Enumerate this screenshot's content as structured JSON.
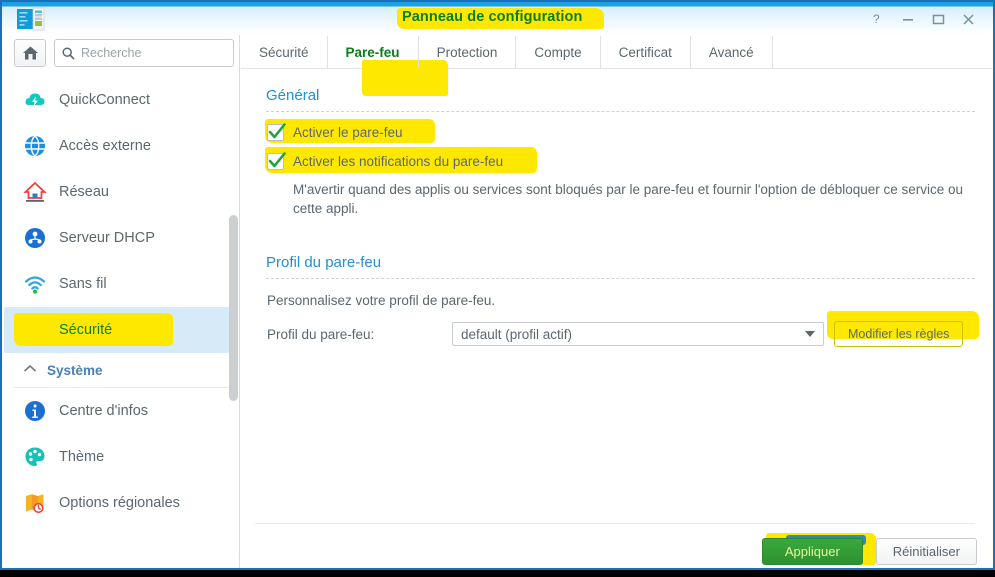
{
  "window": {
    "title": "Panneau de configuration",
    "app_icon": "control-panel-icon",
    "controls": [
      {
        "name": "help-button",
        "glyph": "?"
      },
      {
        "name": "minimize-button",
        "glyph": "–"
      },
      {
        "name": "maximize-button",
        "glyph": "☐"
      },
      {
        "name": "close-button",
        "glyph": "✕"
      }
    ]
  },
  "sidebar": {
    "home_button_label": "home-icon",
    "search": {
      "placeholder": "Recherche",
      "value": ""
    },
    "items": [
      {
        "label": "QuickConnect",
        "icon": "quickconnect-cloud-icon",
        "selected": false
      },
      {
        "label": "Accès externe",
        "icon": "globe-icon",
        "selected": false
      },
      {
        "label": "Réseau",
        "icon": "network-house-icon",
        "selected": false
      },
      {
        "label": "Serveur DHCP",
        "icon": "dhcp-server-icon",
        "selected": false
      },
      {
        "label": "Sans fil",
        "icon": "wifi-icon",
        "selected": false
      },
      {
        "label": "Sécurité",
        "icon": "shield-icon",
        "selected": true
      }
    ],
    "group_header": {
      "label": "Système",
      "icon": "chevron-up-icon"
    },
    "system_items": [
      {
        "label": "Centre d'infos",
        "icon": "info-icon"
      },
      {
        "label": "Thème",
        "icon": "palette-icon"
      },
      {
        "label": "Options régionales",
        "icon": "regional-options-icon"
      }
    ]
  },
  "tabs": [
    {
      "label": "Sécurité",
      "active": false
    },
    {
      "label": "Pare-feu",
      "active": true
    },
    {
      "label": "Protection",
      "active": false
    },
    {
      "label": "Compte",
      "active": false
    },
    {
      "label": "Certificat",
      "active": false
    },
    {
      "label": "Avancé",
      "active": false
    }
  ],
  "main": {
    "general": {
      "title": "Général",
      "checkbox_firewall": {
        "label": "Activer le pare-feu",
        "checked": true
      },
      "checkbox_notifications": {
        "label": "Activer les notifications du pare-feu",
        "checked": true
      },
      "description": "M'avertir quand des applis ou services sont bloqués par le pare-feu et fournir l'option de débloquer ce service ou cette appli."
    },
    "profile": {
      "title": "Profil du pare-feu",
      "subtitle": "Personnalisez votre profil de pare-feu.",
      "field_label": "Profil du pare-feu:",
      "select_value": "default (profil actif)",
      "select_options": [
        "default (profil actif)"
      ],
      "edit_rules_button": "Modifier les règles"
    }
  },
  "footer": {
    "apply_label": "Appliquer",
    "reset_label": "Réinitialiser"
  },
  "colors": {
    "highlight": "#ffe800",
    "accent_blue": "#2090d9",
    "title_blue": "#1ba1e2",
    "highlight_text_green": "#0b7d1d",
    "apply_green": "#39a93b",
    "selected_row": "#d6ebf7"
  }
}
